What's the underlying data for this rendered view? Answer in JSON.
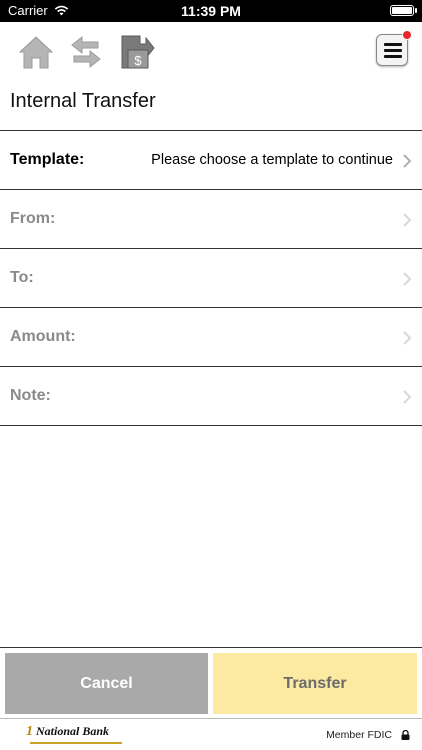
{
  "status_bar": {
    "carrier": "Carrier",
    "time": "11:39 PM",
    "wifi_icon": "wifi-icon",
    "battery_icon": "battery-icon"
  },
  "toolbar": {
    "icons": [
      "home-icon",
      "transfer-arrows-icon",
      "pay-bill-icon"
    ],
    "menu_icon": "hamburger-menu-icon",
    "notification_color": "#e8262b"
  },
  "page": {
    "title": "Internal Transfer"
  },
  "form": {
    "rows": [
      {
        "label": "Template:",
        "value": "Please choose a template to continue",
        "active": true
      },
      {
        "label": "From:",
        "value": ""
      },
      {
        "label": "To:",
        "value": ""
      },
      {
        "label": "Amount:",
        "value": ""
      },
      {
        "label": "Note:",
        "value": ""
      }
    ]
  },
  "buttons": {
    "cancel": "Cancel",
    "transfer": "Transfer",
    "cancel_color": "#a9a9a9",
    "transfer_color": "#fce9a2"
  },
  "footer": {
    "brand_name": "National Bank",
    "brand_mark": "1",
    "member": "Member FDIC",
    "lock_icon": "lock-icon"
  }
}
